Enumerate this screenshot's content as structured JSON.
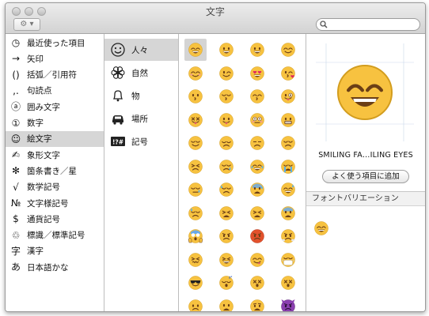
{
  "window": {
    "title": "文字"
  },
  "toolbar": {
    "gear_menu": "⚙ ▾",
    "search_placeholder": ""
  },
  "categories": [
    {
      "icon": "◷",
      "label": "最近使った項目"
    },
    {
      "icon": "→",
      "label": "矢印"
    },
    {
      "icon": "()",
      "label": "括弧／引用符"
    },
    {
      "icon": ",.",
      "label": "句読点"
    },
    {
      "icon": "ⓐ",
      "label": "囲み文字"
    },
    {
      "icon": "①",
      "label": "数字"
    },
    {
      "icon": "☺",
      "label": "絵文字"
    },
    {
      "icon": "✍",
      "label": "象形文字"
    },
    {
      "icon": "✻",
      "label": "箇条書き／星"
    },
    {
      "icon": "√",
      "label": "数学記号"
    },
    {
      "icon": "№",
      "label": "文字様記号"
    },
    {
      "icon": "$",
      "label": "通貨記号"
    },
    {
      "icon": "♲",
      "label": "標識／標準記号"
    },
    {
      "icon": "字",
      "label": "漢字"
    },
    {
      "icon": "あ",
      "label": "日本語かな"
    }
  ],
  "selected_category": 6,
  "subcategories": [
    {
      "icon": "smiley-icon",
      "label": "人々"
    },
    {
      "icon": "flower-icon",
      "label": "自然"
    },
    {
      "icon": "bell-icon",
      "label": "物"
    },
    {
      "icon": "car-icon",
      "label": "場所"
    },
    {
      "icon": "symbols-icon",
      "label": "記号"
    }
  ],
  "selected_subcategory": 0,
  "symbols_icon_text": "!?#",
  "emoji_grid": [
    [
      "smile-open-eyes",
      "grin",
      "smiley",
      "smile"
    ],
    [
      "blush",
      "wink",
      "heart-eyes",
      "kissing-heart"
    ],
    [
      "kissing",
      "kissing-closed",
      "kissing-smiling",
      "tongue-wink"
    ],
    [
      "tongue-closed",
      "tongue",
      "flushed",
      "grimacing"
    ],
    [
      "relieved",
      "pensive",
      "unamused",
      "disappointed"
    ],
    [
      "persevere",
      "cry",
      "joy",
      "sob"
    ],
    [
      "sleepy",
      "disappointed-relieved",
      "cold-sweat",
      "sweat-smile"
    ],
    [
      "sweat",
      "weary",
      "tired",
      "fearful"
    ],
    [
      "scream",
      "angry",
      "rage",
      "triumph"
    ],
    [
      "confounded",
      "laughing",
      "yum",
      "mask"
    ],
    [
      "sunglasses",
      "sleeping",
      "dizzy",
      "astonished"
    ],
    [
      "worried",
      "frowning",
      "anguished",
      "imp"
    ]
  ],
  "selected_emoji": [
    0,
    0
  ],
  "detail": {
    "character_name": "SMILING FA…ILING EYES",
    "add_favorite": "よく使う項目に追加",
    "font_variation_header": "フォントバリエーション"
  },
  "colors": {
    "emoji_face": "#f7c240",
    "emoji_dark": "#6b3f16",
    "selection": "#d6d6d6",
    "heart": "#e0245e",
    "rage": "#e2512c",
    "devil": "#8b3fb0"
  }
}
